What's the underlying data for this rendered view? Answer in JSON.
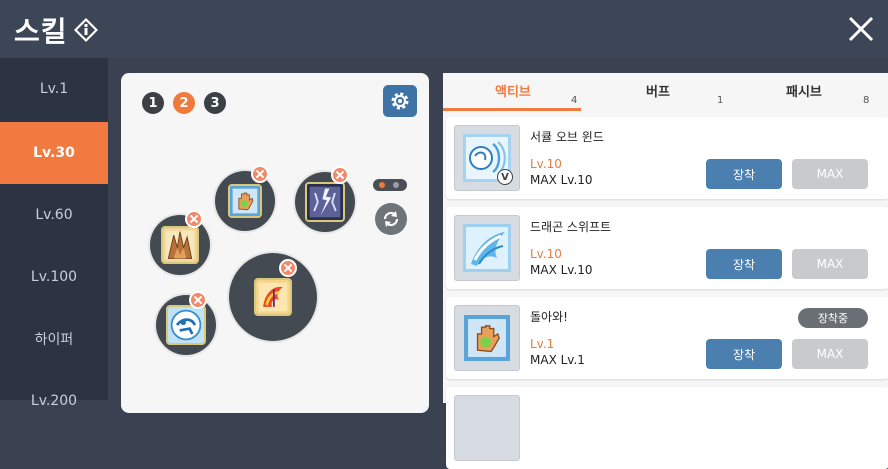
{
  "header": {
    "title": "스킬",
    "info_icon": "info-diamond-icon",
    "close_icon": "close-icon"
  },
  "sidebar": {
    "items": [
      {
        "label": "Lv.1",
        "active": false
      },
      {
        "label": "Lv.30",
        "active": true
      },
      {
        "label": "Lv.60",
        "active": false
      },
      {
        "label": "Lv.100",
        "active": false
      },
      {
        "label": "하이퍼",
        "active": false
      },
      {
        "label": "Lv.200",
        "active": false
      }
    ]
  },
  "presets": {
    "items": [
      "1",
      "2",
      "3"
    ],
    "selected": "2"
  },
  "tabs": [
    {
      "label": "액티브",
      "count": "4",
      "active": true
    },
    {
      "label": "버프",
      "count": "1",
      "active": false
    },
    {
      "label": "패시브",
      "count": "8",
      "active": false
    }
  ],
  "skills": [
    {
      "name": "서큘 오브 윈드",
      "level": "Lv.10",
      "max_level": "MAX Lv.10",
      "equip_label": "장착",
      "max_label": "MAX",
      "equipped": false,
      "badge": "V"
    },
    {
      "name": "드래곤 스위프트",
      "level": "Lv.10",
      "max_level": "MAX Lv.10",
      "equip_label": "장착",
      "max_label": "MAX",
      "equipped": false
    },
    {
      "name": "돌아와!",
      "level": "Lv.1",
      "max_level": "MAX Lv.1",
      "equip_label": "장착",
      "max_label": "MAX",
      "equipped": true,
      "equipped_label": "장착중"
    }
  ],
  "colors": {
    "accent": "#f07a3f",
    "button_blue": "#4a7fb0",
    "sidebar_bg": "#2c3444",
    "header_bg": "#3d4656"
  }
}
